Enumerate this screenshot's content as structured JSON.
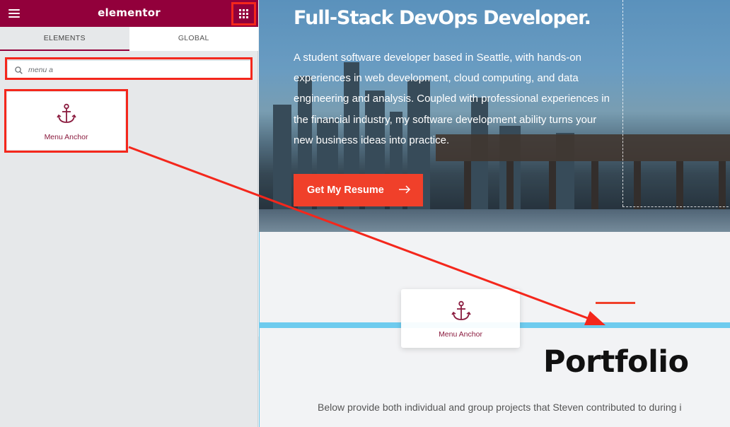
{
  "editor": {
    "brand": "elementor",
    "tabs": [
      {
        "label": "ELEMENTS",
        "active": true
      },
      {
        "label": "GLOBAL",
        "active": false
      }
    ],
    "search": {
      "value": "menu a"
    },
    "widget": {
      "label": "Menu Anchor",
      "icon": "anchor-icon"
    }
  },
  "preview": {
    "hero_title": "Full-Stack DevOps Developer.",
    "hero_description": "A student software developer based in Seattle, with hands-on experiences in web development, cloud computing, and data engineering and analysis. Coupled with professional experiences in the financial industry, my software development ability turns your new business ideas into practice.",
    "resume_button": "Get My Resume",
    "section_title": "Portfolio",
    "section_description": "Below provide both individual and group projects that Steven contributed to during i",
    "drag_widget_label": "Menu Anchor"
  },
  "colors": {
    "brand": "#92003b",
    "accent": "#f0402a",
    "drop_indicator": "#6ecbee",
    "annotation": "#f4271c"
  }
}
